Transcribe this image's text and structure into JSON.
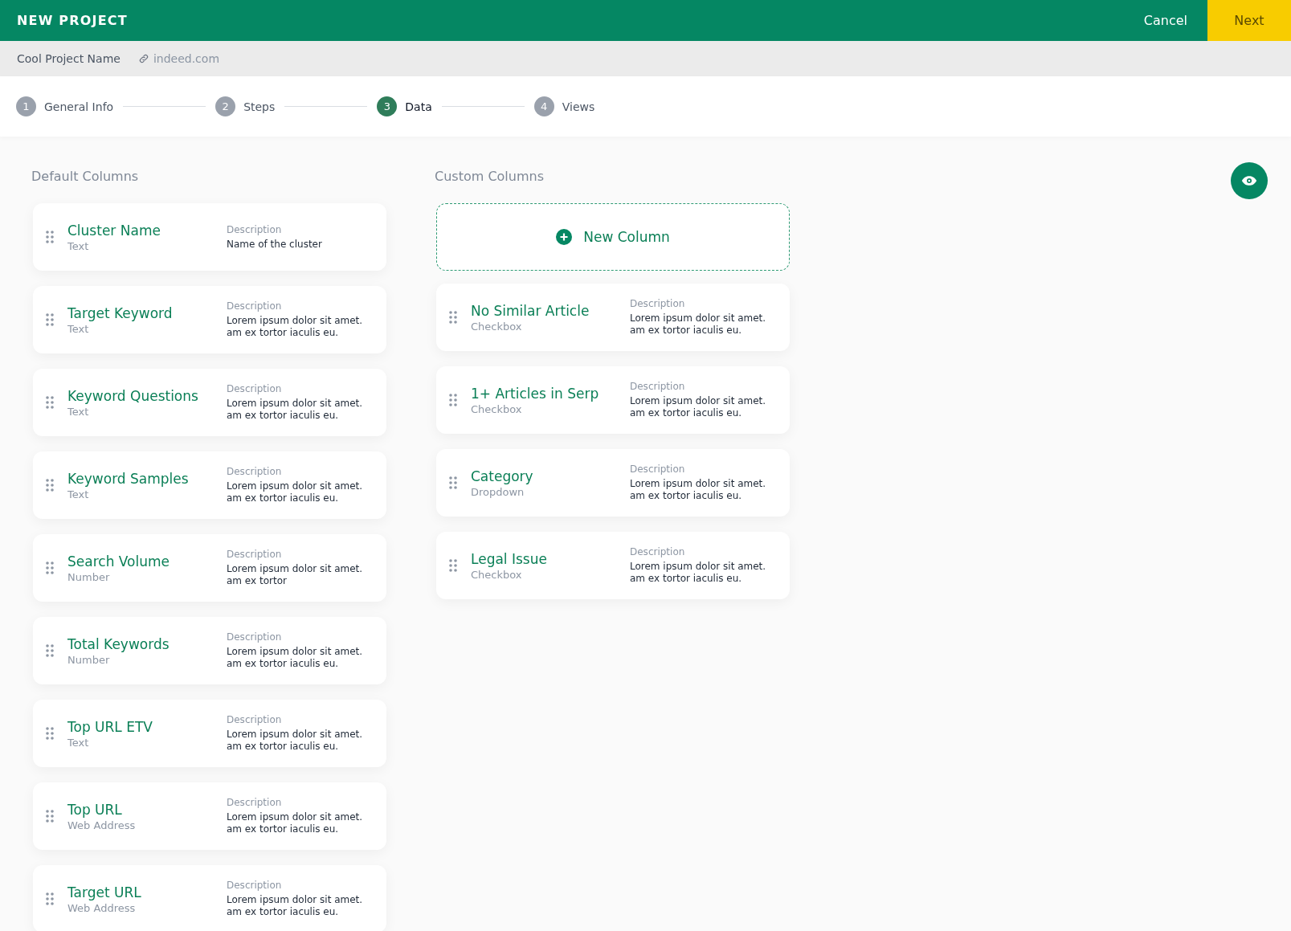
{
  "header": {
    "title": "NEW PROJECT",
    "cancel": "Cancel",
    "next": "Next"
  },
  "project": {
    "name": "Cool Project Name",
    "link": "indeed.com"
  },
  "steps": [
    {
      "number": "1",
      "label": "General Info",
      "selected": false
    },
    {
      "number": "2",
      "label": "Steps",
      "selected": false
    },
    {
      "number": "3",
      "label": "Data",
      "selected": true
    },
    {
      "number": "4",
      "label": "Views",
      "selected": false
    }
  ],
  "default_columns": {
    "heading": "Default Columns",
    "items": [
      {
        "name": "Cluster Name",
        "type": "Text",
        "description_label": "Description",
        "description": "Name of the cluster"
      },
      {
        "name": "Target Keyword",
        "type": "Text",
        "description_label": "Description",
        "description": "Lorem ipsum dolor sit amet. am ex tortor iaculis eu."
      },
      {
        "name": "Keyword Questions",
        "type": "Text",
        "description_label": "Description",
        "description": "Lorem ipsum dolor sit amet. am ex tortor iaculis eu."
      },
      {
        "name": "Keyword Samples",
        "type": "Text",
        "description_label": "Description",
        "description": "Lorem ipsum dolor sit amet. am ex tortor iaculis eu."
      },
      {
        "name": "Search Volume",
        "type": "Number",
        "description_label": "Description",
        "description": "Lorem ipsum dolor sit amet. am ex tortor"
      },
      {
        "name": "Total Keywords",
        "type": "Number",
        "description_label": "Description",
        "description": "Lorem ipsum dolor sit amet. am ex tortor iaculis eu."
      },
      {
        "name": "Top URL ETV",
        "type": "Text",
        "description_label": "Description",
        "description": "Lorem ipsum dolor sit amet. am ex tortor iaculis eu."
      },
      {
        "name": "Top URL",
        "type": "Web Address",
        "description_label": "Description",
        "description": "Lorem ipsum dolor sit amet. am ex tortor iaculis eu."
      },
      {
        "name": "Target URL",
        "type": "Web Address",
        "description_label": "Description",
        "description": "Lorem ipsum dolor sit amet. am ex tortor iaculis eu."
      }
    ]
  },
  "custom_columns": {
    "heading": "Custom Columns",
    "new_column": "New Column",
    "items": [
      {
        "name": "No Similar Article",
        "type": "Checkbox",
        "description_label": "Description",
        "description": "Lorem ipsum dolor sit amet. am ex tortor iaculis eu."
      },
      {
        "name": "1+ Articles in Serp",
        "type": "Checkbox",
        "description_label": "Description",
        "description": "Lorem ipsum dolor sit amet. am ex tortor iaculis eu."
      },
      {
        "name": "Category",
        "type": "Dropdown",
        "description_label": "Description",
        "description": "Lorem ipsum dolor sit amet. am ex tortor iaculis eu."
      },
      {
        "name": "Legal Issue",
        "type": "Checkbox",
        "description_label": "Description",
        "description": "Lorem ipsum dolor sit amet. am ex tortor iaculis eu."
      }
    ]
  }
}
